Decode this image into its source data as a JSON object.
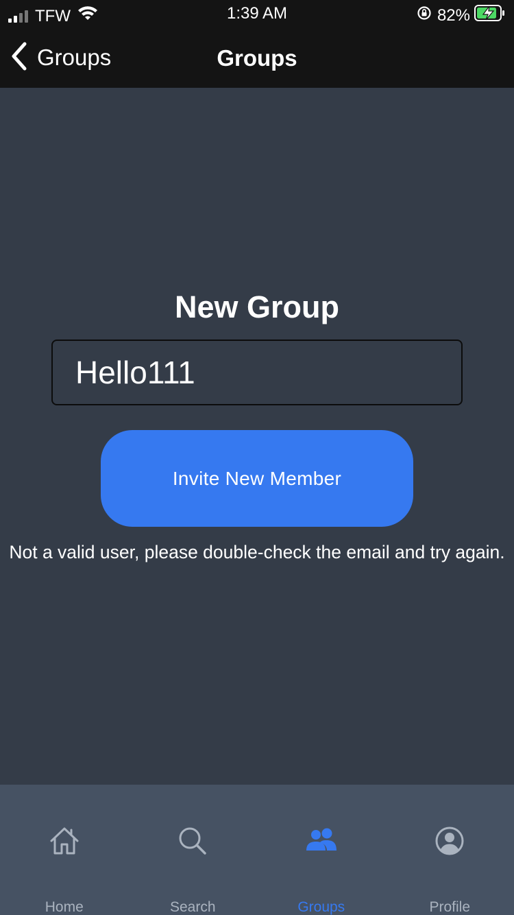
{
  "status_bar": {
    "carrier": "TFW",
    "time": "1:39 AM",
    "battery_percent": "82%"
  },
  "nav": {
    "back_label": "Groups",
    "title": "Groups"
  },
  "main": {
    "title": "New Group",
    "group_name_value": "Hello111",
    "invite_button_label": "Invite New Member",
    "error_message": "Not a valid user, please double-check the email and try again."
  },
  "tabs": [
    {
      "label": "Home",
      "icon": "home-icon",
      "active": false
    },
    {
      "label": "Search",
      "icon": "search-icon",
      "active": false
    },
    {
      "label": "Groups",
      "icon": "users-icon",
      "active": true
    },
    {
      "label": "Profile",
      "icon": "user-circle-icon",
      "active": false
    }
  ],
  "colors": {
    "accent": "#3679f0",
    "background": "#343c48",
    "bar_background": "#141414",
    "tab_bar_background": "#465263",
    "tab_inactive": "#aab3bf"
  }
}
